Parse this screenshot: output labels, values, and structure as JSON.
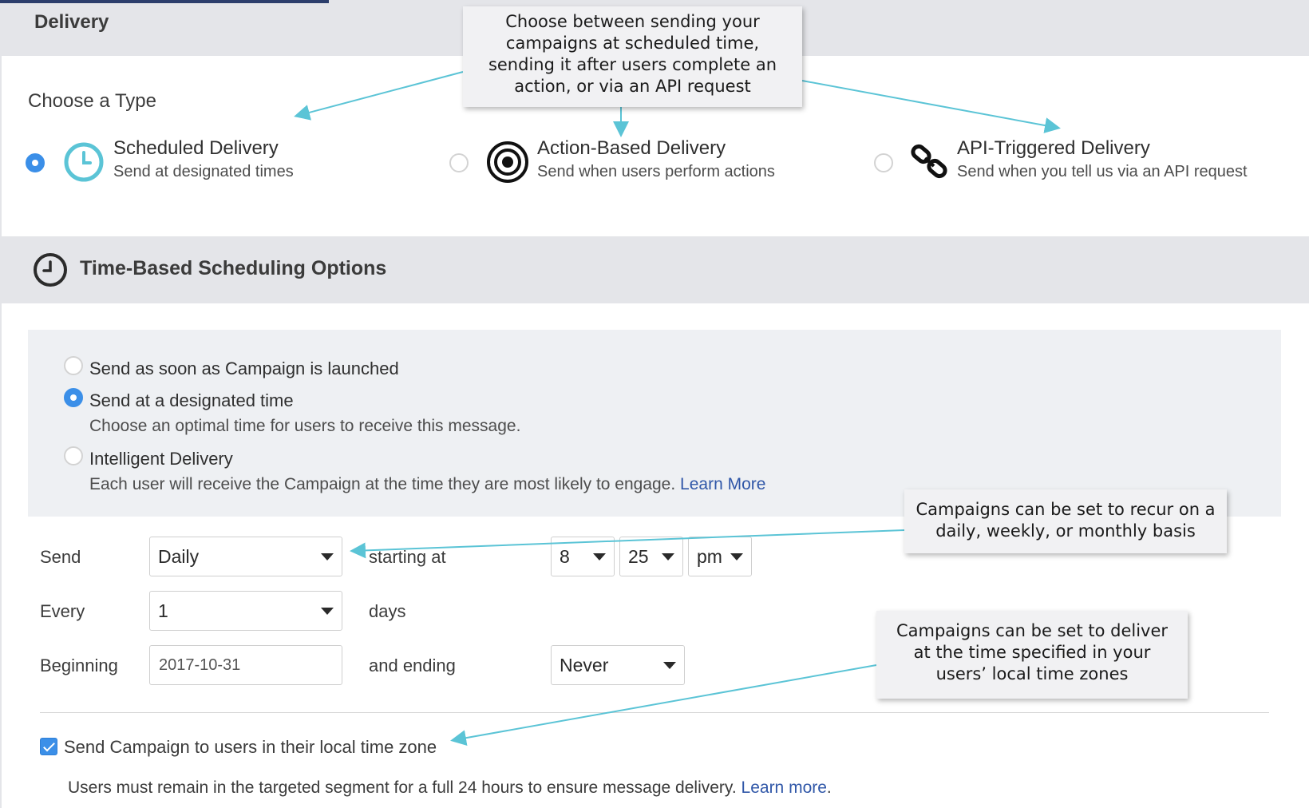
{
  "header": {
    "title": "Delivery"
  },
  "type_section": {
    "heading": "Choose a Type",
    "options": [
      {
        "title": "Scheduled Delivery",
        "subtitle": "Send at designated times",
        "selected": true,
        "icon": "clock-icon"
      },
      {
        "title": "Action-Based Delivery",
        "subtitle": "Send when users perform actions",
        "selected": false,
        "icon": "target-icon"
      },
      {
        "title": "API-Triggered Delivery",
        "subtitle": "Send when you tell us via an API request",
        "selected": false,
        "icon": "link-icon"
      }
    ]
  },
  "scheduling": {
    "title": "Time-Based Scheduling Options",
    "icon": "clock-icon",
    "options": [
      {
        "label": "Send as soon as Campaign is launched",
        "selected": false
      },
      {
        "label": "Send at a designated time",
        "help": "Choose an optimal time for users to receive this message.",
        "selected": true
      },
      {
        "label": "Intelligent Delivery",
        "help": "Each user will receive the Campaign at the time they are most likely to engage.",
        "link": "Learn More",
        "selected": false
      }
    ]
  },
  "form": {
    "send_label": "Send",
    "send_value": "Daily",
    "starting_label": "starting at",
    "hour": "8",
    "minute": "25",
    "ampm": "pm",
    "every_label": "Every",
    "every_value": "1",
    "every_unit": "days",
    "beginning_label": "Beginning",
    "beginning_value": "2017-10-31",
    "ending_label": "and ending",
    "ending_value": "Never"
  },
  "local_tz": {
    "label": "Send Campaign to users in their local time zone",
    "checked": true,
    "note": "Users must remain in the targeted segment for a full 24 hours to ensure message delivery.",
    "note_link": "Learn more",
    "note_end": "."
  },
  "callouts": {
    "type": [
      "Choose between sending your",
      "campaigns at scheduled time,",
      "sending it after users complete an",
      "action, or via an API request"
    ],
    "recur": [
      "Campaigns can be set to recur on a",
      "daily, weekly, or monthly basis"
    ],
    "timezone": [
      "Campaigns can be set to deliver",
      "at the time specified in your",
      "users’ local time zones"
    ]
  },
  "colors": {
    "accent": "#3b8fe8",
    "teal": "#5bc4d6",
    "band": "#e4e5e9",
    "link": "#3057a8"
  }
}
